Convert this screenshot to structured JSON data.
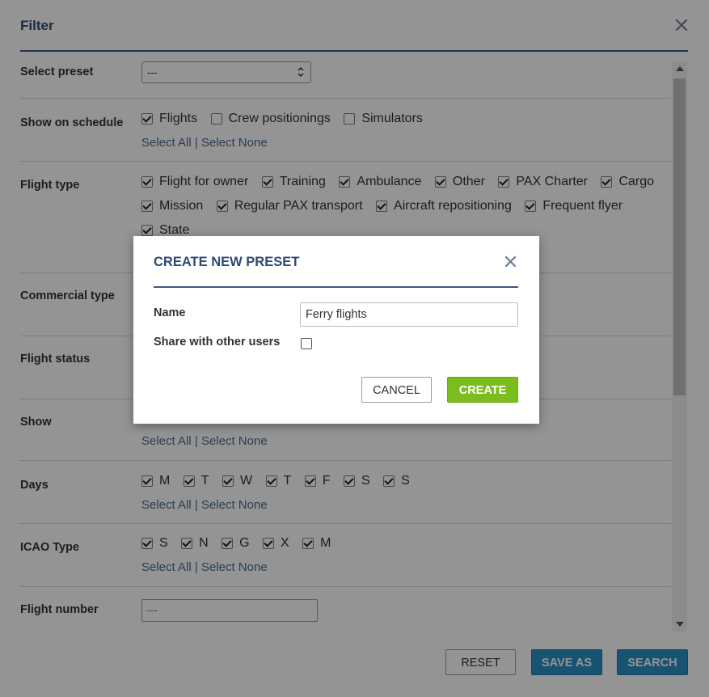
{
  "filter": {
    "title": "Filter",
    "rows": {
      "preset": {
        "label": "Select preset",
        "value": "---"
      },
      "schedule": {
        "label": "Show on schedule",
        "options": [
          {
            "label": "Flights",
            "checked": true
          },
          {
            "label": "Crew positionings",
            "checked": false
          },
          {
            "label": "Simulators",
            "checked": false
          }
        ]
      },
      "flight_type": {
        "label": "Flight type",
        "options": [
          {
            "label": "Flight for owner",
            "checked": true
          },
          {
            "label": "Training",
            "checked": true
          },
          {
            "label": "Ambulance",
            "checked": true
          },
          {
            "label": "Other",
            "checked": true
          },
          {
            "label": "PAX Charter",
            "checked": true
          },
          {
            "label": "Cargo",
            "checked": true
          },
          {
            "label": "Mission",
            "checked": true
          },
          {
            "label": "Regular PAX transport",
            "checked": true
          },
          {
            "label": "Aircraft repositioning",
            "checked": true
          },
          {
            "label": "Frequent flyer",
            "checked": true
          },
          {
            "label": "State",
            "checked": true
          }
        ]
      },
      "commercial": {
        "label": "Commercial type"
      },
      "status": {
        "label": "Flight status"
      },
      "show": {
        "label": "Show"
      },
      "days": {
        "label": "Days",
        "options": [
          {
            "label": "M",
            "checked": true
          },
          {
            "label": "T",
            "checked": true
          },
          {
            "label": "W",
            "checked": true
          },
          {
            "label": "T",
            "checked": true
          },
          {
            "label": "F",
            "checked": true
          },
          {
            "label": "S",
            "checked": true
          },
          {
            "label": "S",
            "checked": true
          }
        ]
      },
      "icao": {
        "label": "ICAO Type",
        "options": [
          {
            "label": "S",
            "checked": true
          },
          {
            "label": "N",
            "checked": true
          },
          {
            "label": "G",
            "checked": true
          },
          {
            "label": "X",
            "checked": true
          },
          {
            "label": "M",
            "checked": true
          }
        ]
      },
      "flight_number": {
        "label": "Flight number",
        "placeholder": "---"
      }
    },
    "select_all": "Select All",
    "separator": "|",
    "select_none": "Select None",
    "buttons": {
      "reset": "RESET",
      "save_as": "SAVE AS",
      "search": "SEARCH"
    }
  },
  "dialog": {
    "title": "CREATE NEW PRESET",
    "name_label": "Name",
    "name_value": "Ferry flights",
    "share_label": "Share with other users",
    "share_checked": false,
    "cancel": "CANCEL",
    "create": "CREATE"
  },
  "colors": {
    "accent": "#2c4a73",
    "primary_button": "#2a8fc4",
    "create_button": "#7cbd1e"
  }
}
